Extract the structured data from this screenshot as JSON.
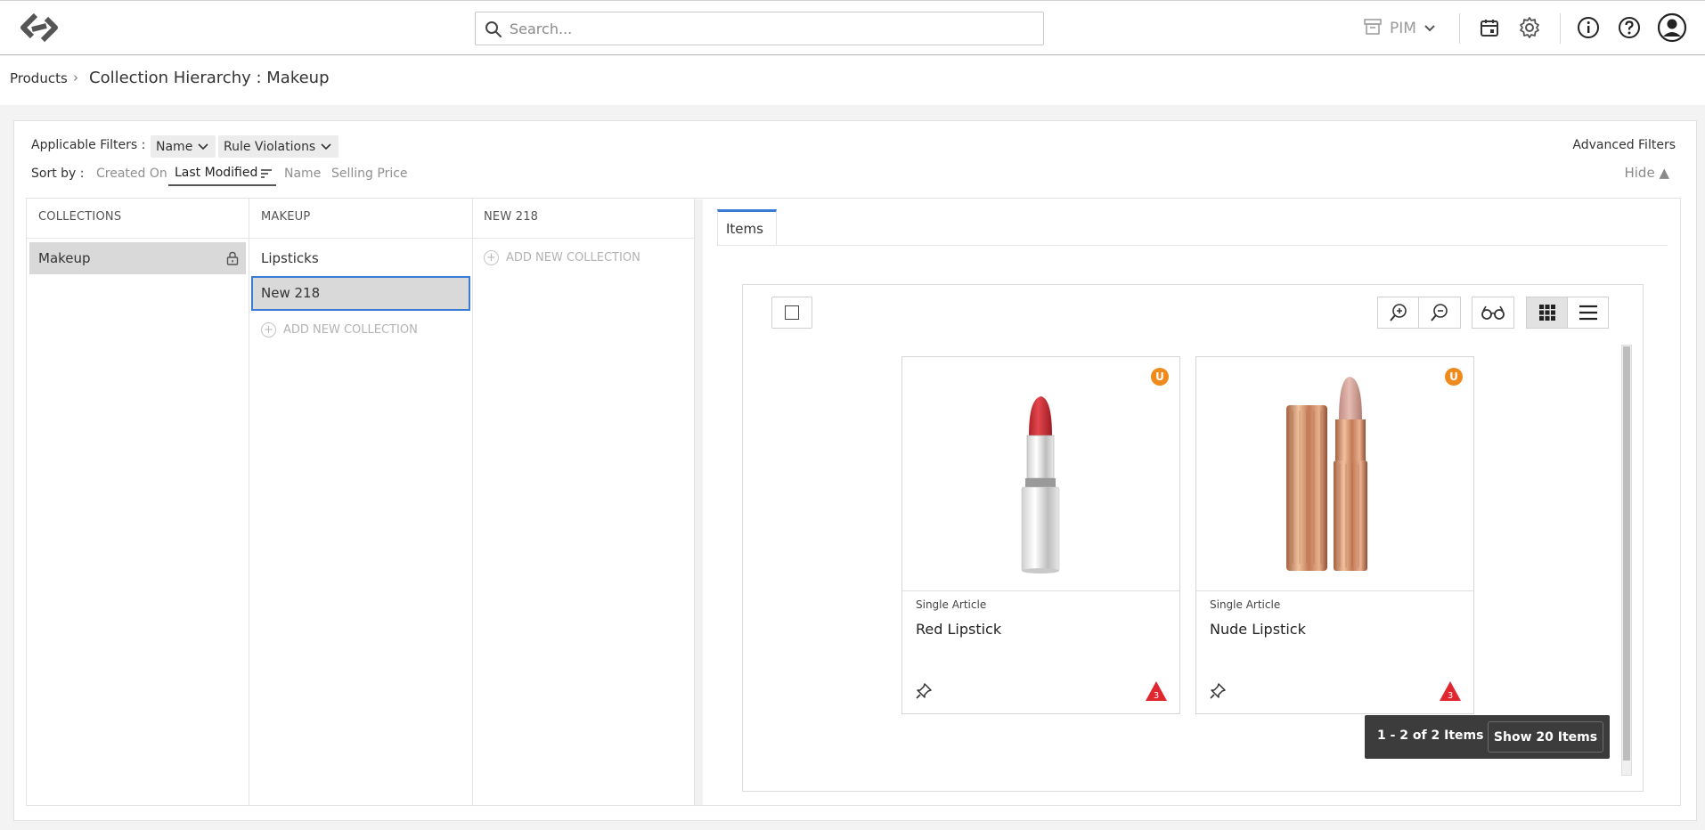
{
  "search": {
    "placeholder": "Search..."
  },
  "header": {
    "app_switch_label": "PIM"
  },
  "breadcrumb": {
    "root": "Products",
    "separator": "›",
    "title": "Collection Hierarchy : Makeup"
  },
  "filters": {
    "label": "Applicable Filters :",
    "chips": [
      "Name",
      "Rule Violations"
    ],
    "advanced_label": "Advanced Filters",
    "hide_label": "Hide ▲"
  },
  "sort": {
    "label": "Sort by :",
    "options": [
      "Created On",
      "Last Modified",
      "Name",
      "Selling Price"
    ],
    "active": "Last Modified"
  },
  "columns": [
    {
      "header": "COLLECTIONS",
      "items": [
        "Makeup"
      ],
      "selected": "Makeup",
      "locked": true
    },
    {
      "header": "MAKEUP",
      "items": [
        "Lipsticks",
        "New 218"
      ],
      "selected": "New 218",
      "add_label": "ADD NEW COLLECTION"
    },
    {
      "header": "NEW 218",
      "items": [],
      "add_label": "ADD NEW COLLECTION"
    }
  ],
  "tabs": [
    {
      "label": "Items",
      "active": true
    }
  ],
  "view": {
    "mode": "grid"
  },
  "items": [
    {
      "type": "Single Article",
      "name": "Red Lipstick",
      "badge": "U",
      "violations": "3",
      "color": "#d8343c"
    },
    {
      "type": "Single Article",
      "name": "Nude Lipstick",
      "badge": "U",
      "violations": "3",
      "color": "#d6a59a"
    }
  ],
  "pager": {
    "count_label": "1 - 2 of 2 Items",
    "show_label": "Show 20 Items"
  },
  "colors": {
    "accent": "#3a7bd5",
    "badge": "#f08a1c",
    "warning": "#e0262e",
    "selection_border": "#3a7bd5"
  }
}
